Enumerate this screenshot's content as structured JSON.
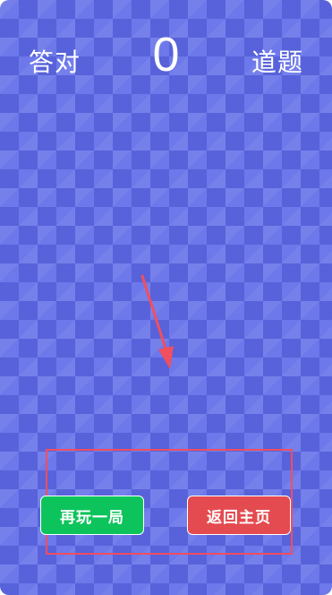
{
  "score": {
    "prefix_label": "答对",
    "value": "0",
    "suffix_label": "道题"
  },
  "buttons": {
    "replay_label": "再玩一局",
    "home_label": "返回主页"
  },
  "colors": {
    "background": "#6d78ea",
    "replay_button": "#0cc45b",
    "home_button": "#e34b50",
    "annotation": "#ef4f5f"
  },
  "icons": {
    "annotation_arrow": "arrow-down-icon"
  }
}
